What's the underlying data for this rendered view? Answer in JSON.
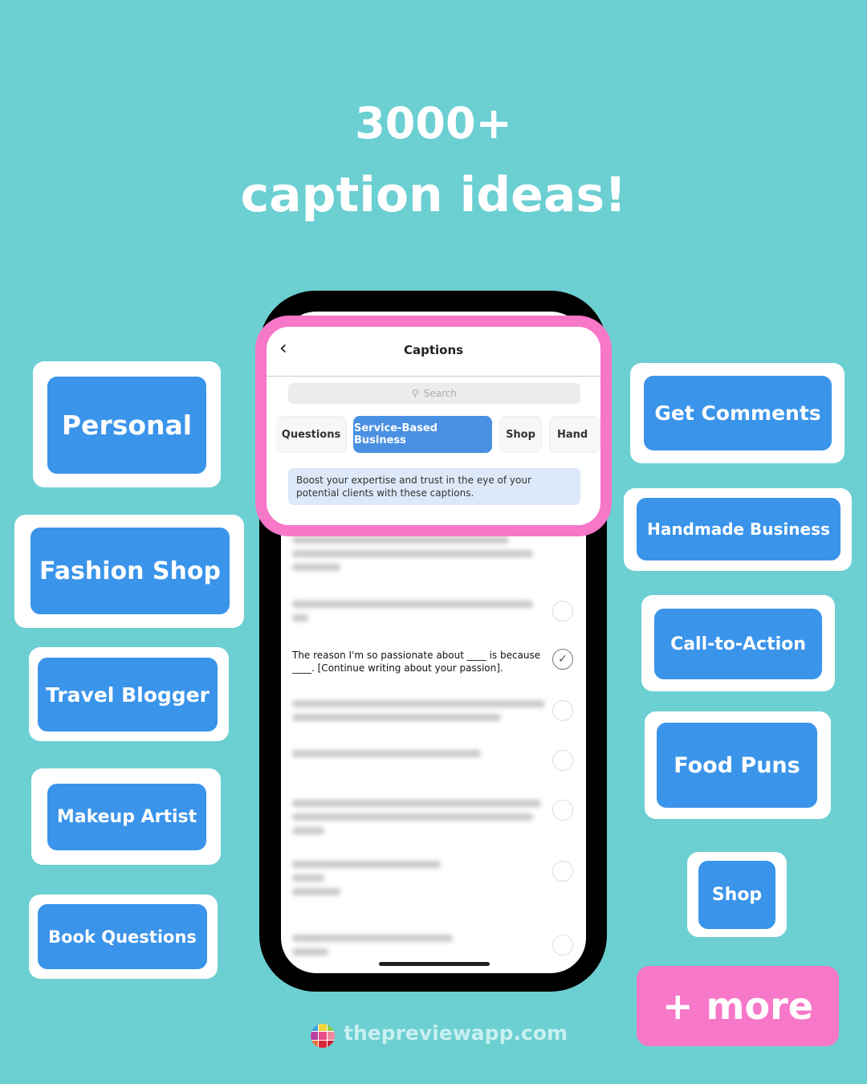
{
  "headline": {
    "line1": "3000+",
    "line2": "caption ideas!"
  },
  "left_buttons": [
    "Personal",
    "Fashion Shop",
    "Travel Blogger",
    "Makeup Artist",
    "Book Questions"
  ],
  "right_buttons": [
    "Get Comments",
    "Handmade Business",
    "Call-to-Action",
    "Food Puns",
    "Shop"
  ],
  "more_label": "+ more",
  "footer": {
    "site": "thepreviewapp.com"
  },
  "app": {
    "title": "Captions",
    "search_placeholder": "Search",
    "tabs": [
      "Questions",
      "Service-Based Business",
      "Shop",
      "Hand"
    ],
    "active_tab": "Service-Based Business",
    "description": "Boost your expertise and trust in the eye of your potential clients with these captions.",
    "visible_caption": "The reason I'm so passionate about ____ is because ____. [Continue writing about your passion]."
  },
  "colors": {
    "background": "#6ccfd2",
    "button_blue": "#3a94ea",
    "accent_pink": "#f777c8"
  }
}
